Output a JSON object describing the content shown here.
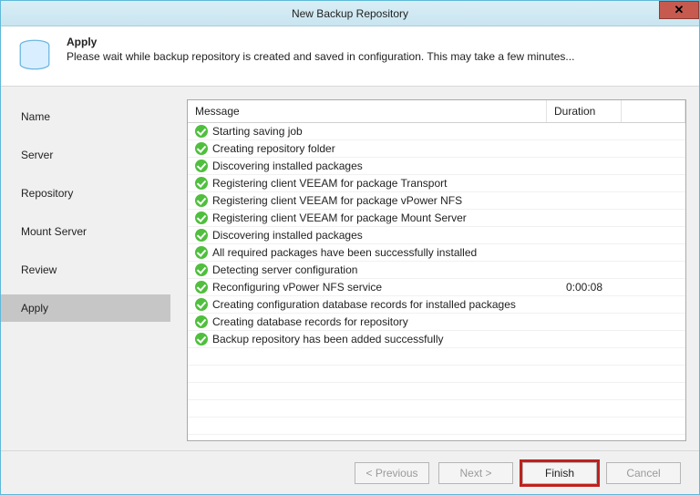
{
  "window": {
    "title": "New Backup Repository",
    "close_glyph": "✕"
  },
  "header": {
    "title": "Apply",
    "description": "Please wait while backup repository is created and saved in configuration. This may take a few minutes..."
  },
  "sidebar": {
    "items": [
      {
        "label": "Name"
      },
      {
        "label": "Server"
      },
      {
        "label": "Repository"
      },
      {
        "label": "Mount Server"
      },
      {
        "label": "Review"
      },
      {
        "label": "Apply"
      }
    ],
    "active_index": 5
  },
  "table": {
    "columns": {
      "message": "Message",
      "duration": "Duration"
    },
    "rows": [
      {
        "message": "Starting saving job",
        "duration": ""
      },
      {
        "message": "Creating repository folder",
        "duration": ""
      },
      {
        "message": "Discovering installed packages",
        "duration": ""
      },
      {
        "message": "Registering client VEEAM for package Transport",
        "duration": ""
      },
      {
        "message": "Registering client VEEAM for package vPower NFS",
        "duration": ""
      },
      {
        "message": "Registering client VEEAM for package Mount Server",
        "duration": ""
      },
      {
        "message": "Discovering installed packages",
        "duration": ""
      },
      {
        "message": "All required packages have been successfully installed",
        "duration": ""
      },
      {
        "message": "Detecting server configuration",
        "duration": ""
      },
      {
        "message": "Reconfiguring vPower NFS service",
        "duration": "0:00:08"
      },
      {
        "message": "Creating configuration database records for installed packages",
        "duration": ""
      },
      {
        "message": "Creating database records for repository",
        "duration": ""
      },
      {
        "message": "Backup repository has been added successfully",
        "duration": ""
      }
    ]
  },
  "footer": {
    "previous": "< Previous",
    "next": "Next >",
    "finish": "Finish",
    "cancel": "Cancel"
  }
}
